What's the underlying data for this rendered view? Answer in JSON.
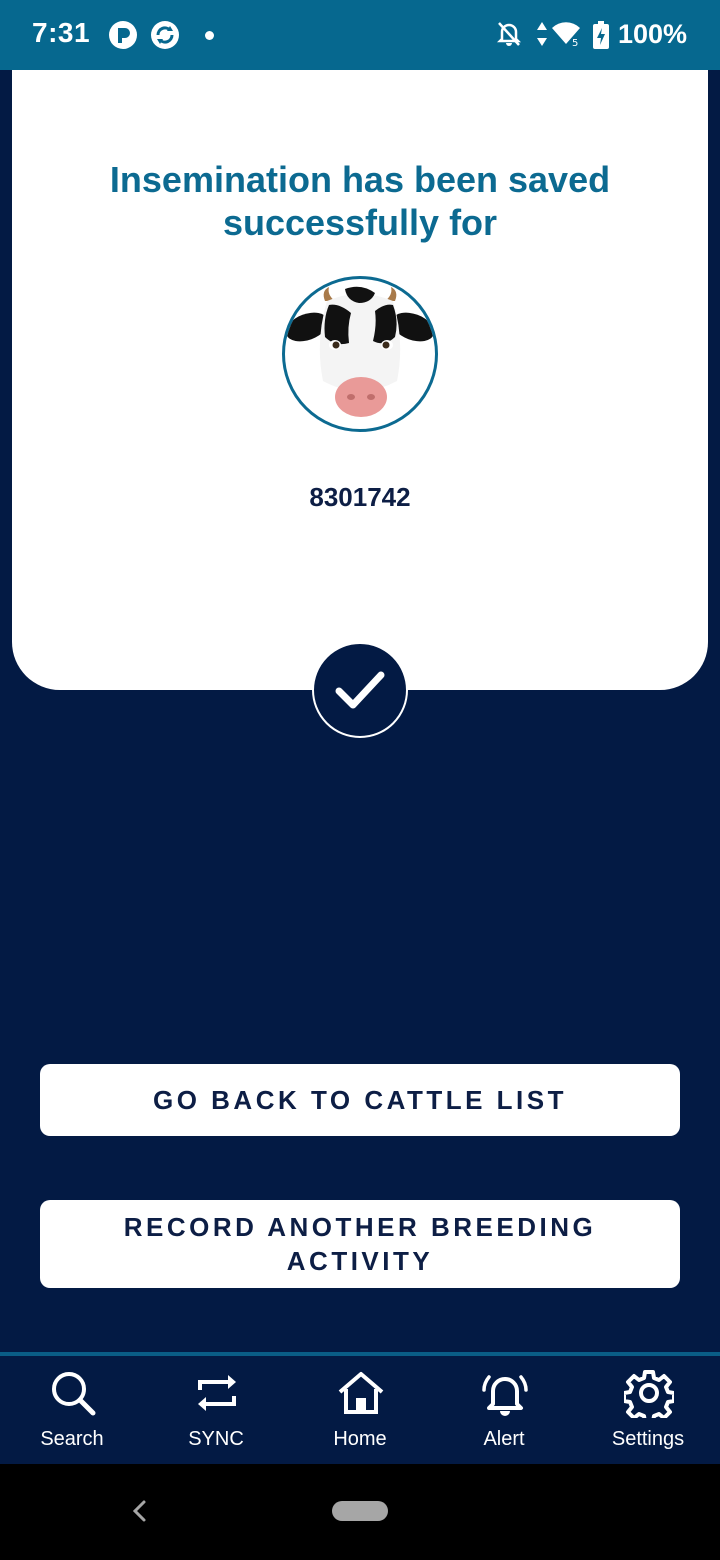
{
  "status_bar": {
    "time": "7:31",
    "battery": "100%",
    "icons": [
      "app-p-icon",
      "app-sync-icon",
      "notifications-off-icon",
      "data-arrows-icon",
      "wifi-icon",
      "battery-charging-icon"
    ]
  },
  "success": {
    "title": "Insemination has been saved successfully for",
    "animal_id": "8301742",
    "avatar_icon": "cow-avatar-icon",
    "status_icon": "checkmark-icon"
  },
  "actions": {
    "back_label": "GO BACK TO CATTLE LIST",
    "record_label": "RECORD ANOTHER BREEDING ACTIVITY"
  },
  "bottom_nav": {
    "items": [
      {
        "label": "Search",
        "icon": "search-icon"
      },
      {
        "label": "SYNC",
        "icon": "sync-icon"
      },
      {
        "label": "Home",
        "icon": "home-icon"
      },
      {
        "label": "Alert",
        "icon": "bell-icon"
      },
      {
        "label": "Settings",
        "icon": "gear-icon"
      }
    ]
  },
  "colors": {
    "background": "#031a44",
    "accent": "#0c6a91",
    "status_bar": "#06688f",
    "card": "#ffffff"
  }
}
